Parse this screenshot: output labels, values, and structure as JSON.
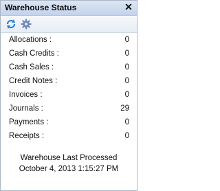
{
  "window": {
    "title": "Warehouse Status"
  },
  "toolbar": {
    "refresh_icon": "refresh-icon",
    "settings_icon": "gear-icon"
  },
  "rows": [
    {
      "label": "Allocations :",
      "value": "0"
    },
    {
      "label": "Cash Credits :",
      "value": "0"
    },
    {
      "label": "Cash Sales :",
      "value": "0"
    },
    {
      "label": "Credit Notes :",
      "value": "0"
    },
    {
      "label": "Invoices :",
      "value": "0"
    },
    {
      "label": "Journals :",
      "value": "29"
    },
    {
      "label": "Payments :",
      "value": "0"
    },
    {
      "label": "Receipts :",
      "value": "0"
    }
  ],
  "footer": {
    "label": "Warehouse Last Processed",
    "timestamp": "October 4, 2013 1:15:27 PM"
  },
  "colors": {
    "accent": "#2f7fd6",
    "titlebar": "#c3d3ea"
  }
}
